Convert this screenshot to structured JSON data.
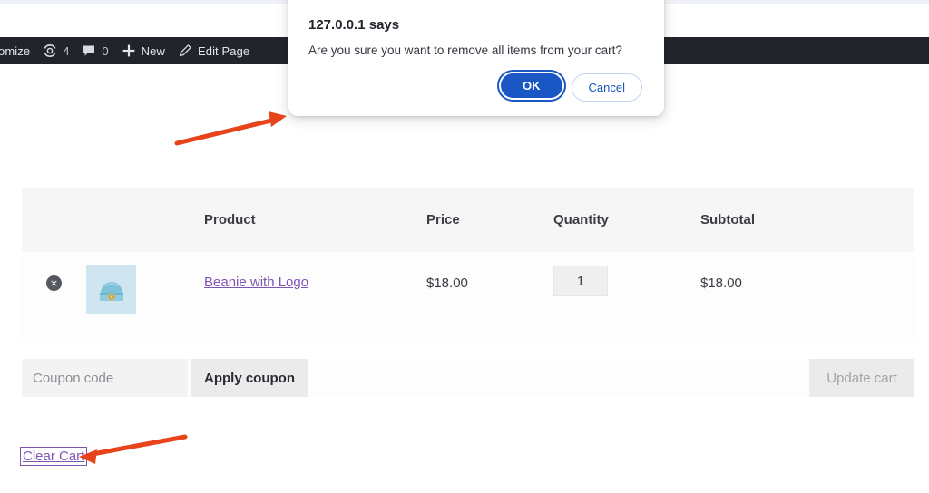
{
  "admin_bar": {
    "items": [
      {
        "name": "customize",
        "icon": "",
        "label": "omize",
        "count": ""
      },
      {
        "name": "updates",
        "icon": "update-icon",
        "label": "",
        "count": "4"
      },
      {
        "name": "comments",
        "icon": "comment-icon",
        "label": "",
        "count": "0"
      },
      {
        "name": "new",
        "icon": "plus-icon",
        "label": "New",
        "count": ""
      },
      {
        "name": "edit-page",
        "icon": "pencil-icon",
        "label": "Edit Page",
        "count": ""
      }
    ]
  },
  "cart": {
    "headers": {
      "remove": "",
      "thumbnail": "",
      "product": "Product",
      "price": "Price",
      "quantity": "Quantity",
      "subtotal": "Subtotal"
    },
    "rows": [
      {
        "remove_label": "×",
        "product_name": "Beanie with Logo",
        "price": "$18.00",
        "quantity": "1",
        "subtotal": "$18.00"
      }
    ],
    "coupon": {
      "placeholder": "Coupon code",
      "value": "",
      "apply_label": "Apply coupon"
    },
    "update_cart_label": "Update cart",
    "clear_cart_label": "Clear Cart"
  },
  "dialog": {
    "title": "127.0.0.1 says",
    "message": "Are you sure you want to remove all items from your cart?",
    "ok_label": "OK",
    "cancel_label": "Cancel"
  },
  "colors": {
    "admin_bar_bg": "#21252b",
    "link_purple": "#7f54b3",
    "dialog_blue": "#1a56c4",
    "arrow_orange": "#e8441c",
    "thumb_bg": "#cfe6f0"
  }
}
